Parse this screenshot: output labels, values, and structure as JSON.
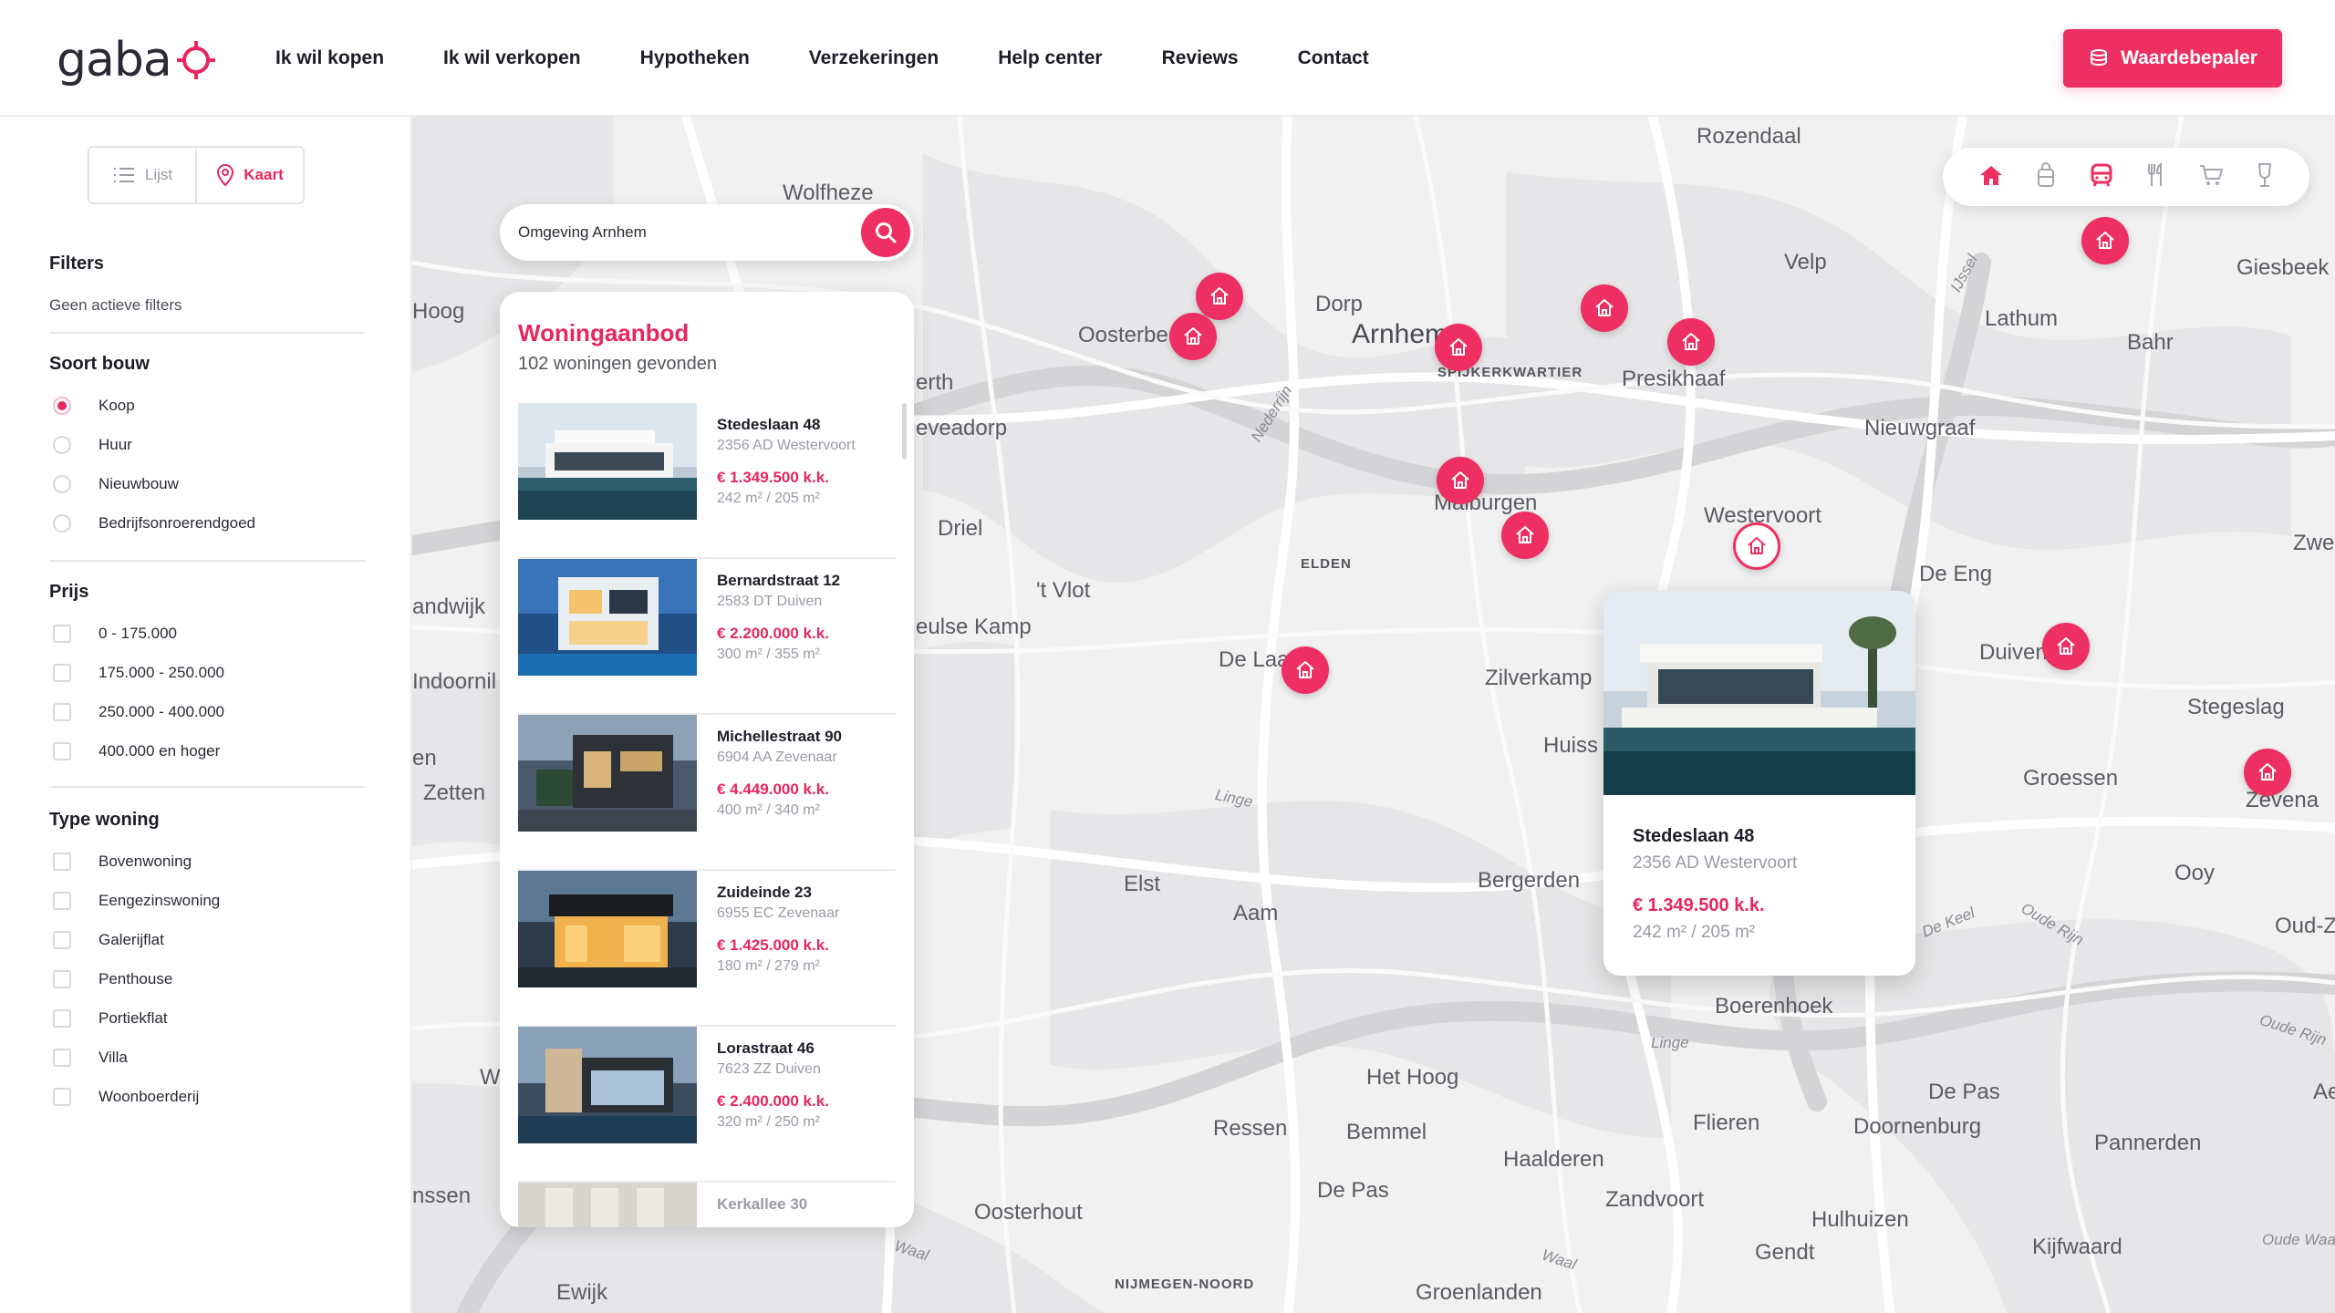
{
  "header": {
    "logo": "gaba",
    "nav": [
      "Ik wil kopen",
      "Ik wil verkopen",
      "Hypotheken",
      "Verzekeringen",
      "Help center",
      "Reviews",
      "Contact"
    ],
    "cta_label": "Waardebepaler"
  },
  "sidebar": {
    "view_toggle": {
      "list_label": "Lijst",
      "map_label": "Kaart",
      "active": "map"
    },
    "filters_title": "Filters",
    "filters_status": "Geen actieve filters",
    "build_type": {
      "title": "Soort bouw",
      "options": [
        "Koop",
        "Huur",
        "Nieuwbouw",
        "Bedrijfsonroerendgoed"
      ],
      "selected": "Koop"
    },
    "price": {
      "title": "Prijs",
      "options": [
        "0 - 175.000",
        "175.000 - 250.000",
        "250.000 - 400.000",
        "400.000 en hoger"
      ]
    },
    "home_type": {
      "title": "Type woning",
      "options": [
        "Bovenwoning",
        "Eengezinswoning",
        "Galerijflat",
        "Penthouse",
        "Portiekflat",
        "Villa",
        "Woonboerderij"
      ]
    }
  },
  "search": {
    "value": "Omgeving Arnhem"
  },
  "listings": {
    "title": "Woningaanbod",
    "count": "102 woningen gevonden",
    "items": [
      {
        "street": "Stedeslaan 48",
        "zip": "2356 AD Westervoort",
        "price": "€ 1.349.500 k.k.",
        "size": "242 m² / 205 m²"
      },
      {
        "street": "Bernardstraat 12",
        "zip": "2583 DT Duiven",
        "price": "€ 2.200.000 k.k.",
        "size": "300 m² / 355 m²"
      },
      {
        "street": "Michellestraat 90",
        "zip": "6904 AA Zevenaar",
        "price": "€ 4.449.000 k.k.",
        "size": "400 m² / 340 m²"
      },
      {
        "street": "Zuideinde 23",
        "zip": "6955 EC Zevenaar",
        "price": "€ 1.425.000 k.k.",
        "size": "180 m² / 279 m²"
      },
      {
        "street": "Lorastraat 46",
        "zip": "7623 ZZ Duiven",
        "price": "€ 2.400.000 k.k.",
        "size": "320 m² / 250 m²"
      },
      {
        "street": "Kerkallee 30",
        "zip": "",
        "price": "",
        "size": ""
      }
    ]
  },
  "popup": {
    "street": "Stedeslaan 48",
    "zip": "2356 AD Westervoort",
    "price": "€ 1.349.500 k.k.",
    "size": "242 m² / 205 m²"
  },
  "map_labels": {
    "rozendaal": "Rozendaal",
    "wolfheze": "Wolfheze",
    "hoog": "Hoog",
    "dorp": "Dorp",
    "oosterbe": "Oosterbe",
    "arnhem": "Arnhem",
    "spijkerkwartier": "SPIJKERKWARTIER",
    "presikhaaf": "Presikhaaf",
    "velp": "Velp",
    "giesbeek": "Giesbeek",
    "lathum": "Lathum",
    "bahr": "Bahr",
    "erth": "erth",
    "eveadorp": "eveadorp",
    "nieuwgraaf": "Nieuwgraaf",
    "driel": "Driel",
    "malburgen": "Malburgen",
    "westervoort": "Westervoort",
    "zweekho": "Zweekho",
    "elden": "ELDEN",
    "andwijk": "andwijk",
    "vlot": "'t Vlot",
    "eulse": "eulse Kamp",
    "deeng": "De Eng",
    "delaa": "De Laa",
    "zilverkamp": "Zilverkamp",
    "duiven": "Duiven",
    "stegeslag": "Stegeslag",
    "indoornil": "Indoornil",
    "huiss": "Huiss",
    "zevena": "Zevena",
    "en": "en",
    "zetten": "Zetten",
    "groessen": "Groessen",
    "elst": "Elst",
    "aam": "Aam",
    "bergerden": "Bergerden",
    "ooy": "Ooy",
    "oudz": "Oud-Ze",
    "boerenhoek": "Boerenhoek",
    "hethoog": "Het Hoog",
    "linge2": "Linge",
    "depas": "De Pas",
    "ae": "Ae",
    "ressen": "Ressen",
    "bemmel": "Bemmel",
    "flieren": "Flieren",
    "doornenburg": "Doornenburg",
    "pannerden": "Pannerden",
    "haalderen": "Haalderen",
    "w": "W",
    "nssen": "nssen",
    "depas2": "De Pas",
    "zandvoort": "Zandvoort",
    "hulhuizen": "Hulhuizen",
    "oosterhout": "Oosterhout",
    "gendt": "Gendt",
    "kijfwaard": "Kijfwaard",
    "ewijk": "Ewijk",
    "nijmegen": "NIJMEGEN-NOORD",
    "groenlanden": "Groenlanden",
    "nederrijn": "Nederrijn",
    "linge": "Linge",
    "ijssel": "IJssel",
    "dekeel": "De Keel",
    "ouderijn": "Oude Rijn",
    "ouderijn2": "Oude Rijn",
    "waal": "Waal",
    "waal2": "Waal",
    "oudewaa": "Oude Waa"
  },
  "categories": [
    "home-icon",
    "school-icon",
    "transit-icon",
    "restaurant-icon",
    "shopping-icon",
    "bar-icon"
  ],
  "colors": {
    "accent": "#ee2f62",
    "text": "#1d1d27",
    "muted": "#9a9aa4",
    "map_bg": "#f1f1f2"
  }
}
